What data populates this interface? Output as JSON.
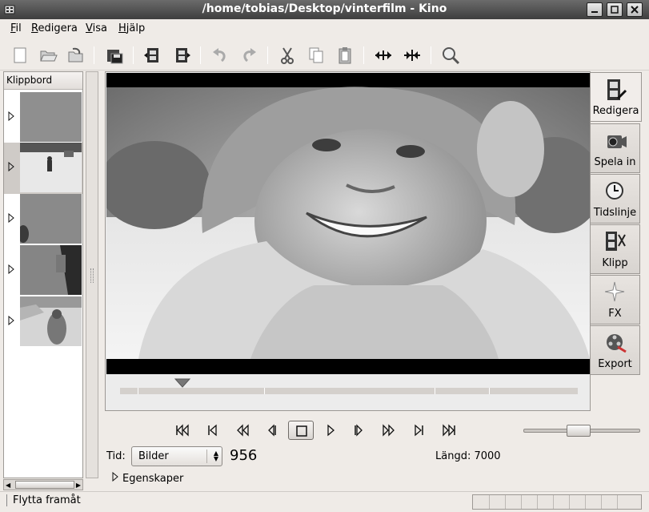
{
  "window": {
    "title": "/home/tobias/Desktop/vinterfilm - Kino"
  },
  "menu": {
    "items": [
      {
        "label": "Fil"
      },
      {
        "label": "Redigera"
      },
      {
        "label": "Visa"
      },
      {
        "label": "Hjälp"
      }
    ]
  },
  "toolbar": {
    "icons": [
      "new-icon",
      "open-icon",
      "save-icon",
      "save-as-icon",
      "insert-before-icon",
      "insert-after-icon",
      "undo-icon",
      "redo-icon",
      "cut-icon",
      "copy-icon",
      "paste-icon",
      "join-icon",
      "split-icon",
      "zoom-icon"
    ]
  },
  "sidebar": {
    "header": "Klippbord",
    "clips": [
      {
        "name": "clip-1",
        "selected": false
      },
      {
        "name": "clip-2",
        "selected": true
      },
      {
        "name": "clip-3",
        "selected": false
      },
      {
        "name": "clip-4",
        "selected": false
      },
      {
        "name": "clip-5",
        "selected": false
      }
    ]
  },
  "tabs": [
    {
      "label": "Redigera",
      "icon": "edit-film-icon",
      "active": true
    },
    {
      "label": "Spela in",
      "icon": "camera-icon",
      "active": false
    },
    {
      "label": "Tidslinje",
      "icon": "clock-icon",
      "active": false
    },
    {
      "label": "Klipp",
      "icon": "film-cut-icon",
      "active": false
    },
    {
      "label": "FX",
      "icon": "sparkle-icon",
      "active": false
    },
    {
      "label": "Export",
      "icon": "film-reel-icon",
      "active": false
    }
  ],
  "transport": {
    "buttons": [
      "start-icon",
      "previous-scene-icon",
      "rewind-icon",
      "back-frame-icon",
      "stop-icon",
      "play-icon",
      "forward-frame-icon",
      "fast-forward-icon",
      "next-scene-icon",
      "end-icon"
    ]
  },
  "time": {
    "label": "Tid:",
    "format": "Bilder",
    "frame": "956",
    "length": "Längd: 7000"
  },
  "properties": {
    "label": "Egenskaper"
  },
  "status": {
    "text": "Flytta framåt"
  }
}
